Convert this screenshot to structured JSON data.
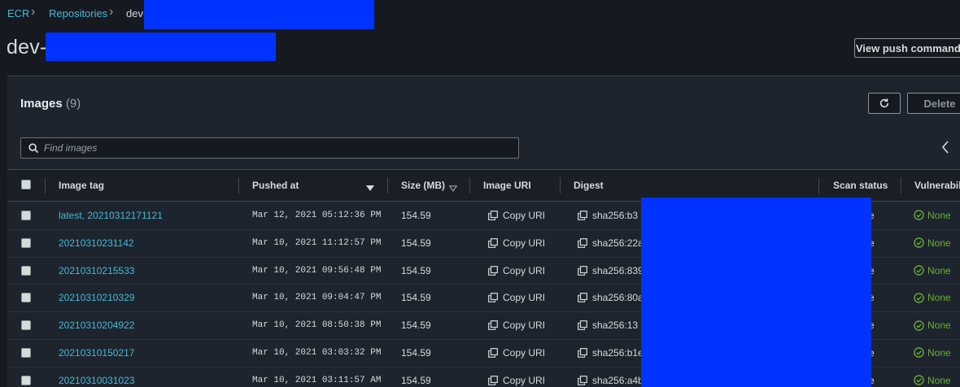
{
  "breadcrumb": {
    "items": [
      "ECR",
      "Repositories",
      "dev-"
    ]
  },
  "page": {
    "title": "dev-",
    "view_push_label": "View push commands"
  },
  "images": {
    "title": "Images",
    "count": "(9)",
    "delete_label": "Delete",
    "search_placeholder": "Find images",
    "columns": [
      "Image tag",
      "Pushed at",
      "Size (MB)",
      "Image URI",
      "Digest",
      "Scan status",
      "Vulnerabilities"
    ],
    "copy_uri_label": "Copy URI",
    "rows": [
      {
        "tag": "latest, 20210312171121",
        "pushed": "Mar 12, 2021 05:12:36 PM",
        "size": "154.59",
        "digest": "sha256:b3",
        "scan": "e",
        "vuln": "None"
      },
      {
        "tag": "20210310231142",
        "pushed": "Mar 10, 2021 11:12:57 PM",
        "size": "154.59",
        "digest": "sha256:22a",
        "scan": "e",
        "vuln": "None"
      },
      {
        "tag": "20210310215533",
        "pushed": "Mar 10, 2021 09:56:48 PM",
        "size": "154.59",
        "digest": "sha256:839",
        "scan": "e",
        "vuln": "None"
      },
      {
        "tag": "20210310210329",
        "pushed": "Mar 10, 2021 09:04:47 PM",
        "size": "154.59",
        "digest": "sha256:80a",
        "scan": "e",
        "vuln": "None"
      },
      {
        "tag": "20210310204922",
        "pushed": "Mar 10, 2021 08:50:38 PM",
        "size": "154.59",
        "digest": "sha256:13",
        "scan": "e",
        "vuln": "None"
      },
      {
        "tag": "20210310150217",
        "pushed": "Mar 10, 2021 03:03:32 PM",
        "size": "154.59",
        "digest": "sha256:b1e",
        "scan": "e",
        "vuln": "None"
      },
      {
        "tag": "20210310031023",
        "pushed": "Mar 10, 2021 03:11:57 AM",
        "size": "154.59",
        "digest": "sha256:a4b",
        "scan": "e",
        "vuln": "None"
      }
    ]
  },
  "colors": {
    "link": "#44b9d6",
    "success": "#6aaf35",
    "redaction": "#0033ff"
  },
  "icons": [
    "chevron-right-icon",
    "refresh-icon",
    "search-icon",
    "chevron-left-icon",
    "sort-down-icon",
    "copy-icon",
    "check-circle-icon"
  ]
}
